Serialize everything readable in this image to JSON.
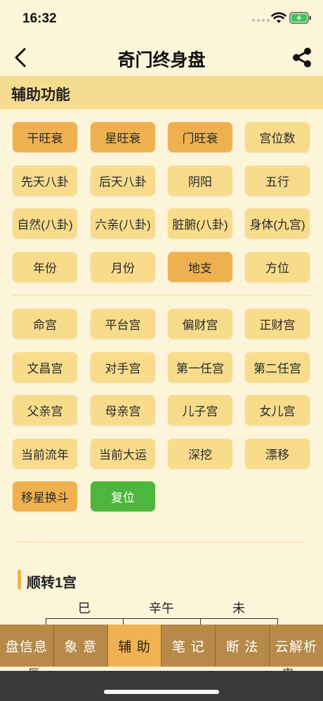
{
  "status": {
    "time": "16:32"
  },
  "nav": {
    "title": "奇门终身盘"
  },
  "section": {
    "title": "辅助功能"
  },
  "group1": [
    {
      "label": "干旺衰",
      "active": true
    },
    {
      "label": "星旺衰",
      "active": true
    },
    {
      "label": "门旺衰",
      "active": true
    },
    {
      "label": "宫位数",
      "active": false
    },
    {
      "label": "先天八卦",
      "active": false
    },
    {
      "label": "后天八卦",
      "active": false
    },
    {
      "label": "阴阳",
      "active": false
    },
    {
      "label": "五行",
      "active": false
    },
    {
      "label": "自然(八卦)",
      "active": false
    },
    {
      "label": "六亲(八卦)",
      "active": false
    },
    {
      "label": "脏腑(八卦)",
      "active": false
    },
    {
      "label": "身体(九宫)",
      "active": false
    },
    {
      "label": "年份",
      "active": false
    },
    {
      "label": "月份",
      "active": false
    },
    {
      "label": "地支",
      "active": true
    },
    {
      "label": "方位",
      "active": false
    }
  ],
  "group2": [
    {
      "label": "命宫",
      "active": false
    },
    {
      "label": "平台宫",
      "active": false
    },
    {
      "label": "偏财宫",
      "active": false
    },
    {
      "label": "正财宫",
      "active": false
    },
    {
      "label": "文昌宫",
      "active": false
    },
    {
      "label": "对手宫",
      "active": false
    },
    {
      "label": "第一任宫",
      "active": false
    },
    {
      "label": "第二任宫",
      "active": false
    },
    {
      "label": "父亲宫",
      "active": false
    },
    {
      "label": "母亲宫",
      "active": false
    },
    {
      "label": "儿子宫",
      "active": false
    },
    {
      "label": "女儿宫",
      "active": false
    },
    {
      "label": "当前流年",
      "active": false
    },
    {
      "label": "当前大运",
      "active": false
    },
    {
      "label": "深挖",
      "active": false
    },
    {
      "label": "漂移",
      "active": false
    },
    {
      "label": "移星换斗",
      "active": true
    },
    {
      "label": "复位",
      "active": false,
      "reset": true
    }
  ],
  "rotation": {
    "title": "顺转1宫",
    "palaces": [
      "巳",
      "辛午",
      "未"
    ],
    "corner_left": "辰",
    "corner_right": "申"
  },
  "tabs": [
    {
      "label": "盘信息",
      "active": false
    },
    {
      "label": "象 意",
      "active": false
    },
    {
      "label": "辅 助",
      "active": true
    },
    {
      "label": "笔 记",
      "active": false
    },
    {
      "label": "断 法",
      "active": false
    },
    {
      "label": "云解析",
      "active": false
    }
  ],
  "colors": {
    "background": "#fdf5d9",
    "button": "#f8dc8c",
    "button_active": "#efb14f",
    "reset": "#4cb63d",
    "tab_bar": "#b78a4a"
  }
}
